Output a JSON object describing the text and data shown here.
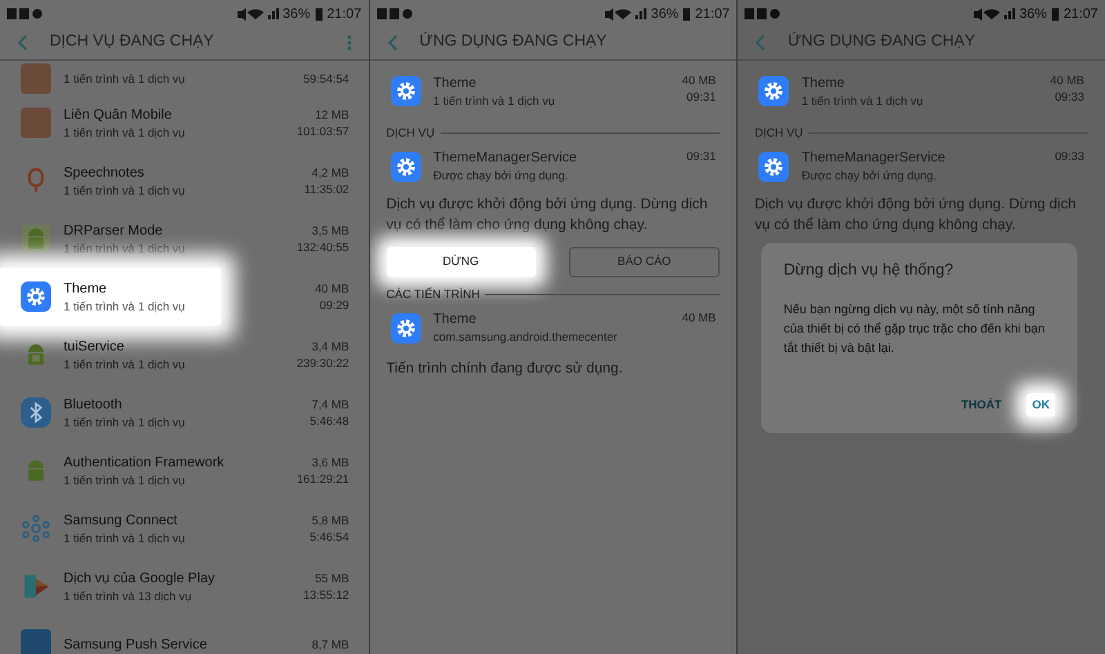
{
  "panels": [
    {
      "kind": "list",
      "status": {
        "battery": "36%",
        "time": "21:07"
      },
      "title": "DỊCH VỤ ĐANG CHẠY",
      "has_menu": true,
      "rows": [
        {
          "kind": "photo",
          "subtitle": "1 tiến trình và 1 dịch vụ",
          "time": "59:54:54",
          "highlighted": false
        },
        {
          "kind": "photo",
          "title": "Liên Quân Mobile",
          "subtitle": "1 tiến trình và 1 dịch vụ",
          "size": "12 MB",
          "time": "101:03:57",
          "highlighted": false
        },
        {
          "kind": "mic",
          "title": "Speechnotes",
          "subtitle": "1 tiến trình và 1 dịch vụ",
          "size": "4,2 MB",
          "time": "11:35:02",
          "highlighted": false
        },
        {
          "kind": "android-box",
          "title": "DRParser Mode",
          "subtitle": "1 tiến trình và 1 dịch vụ",
          "size": "3,5 MB",
          "time": "132:40:55",
          "highlighted": false
        },
        {
          "kind": "gear",
          "title": "Theme",
          "subtitle": "1 tiến trình và 1 dịch vụ",
          "size": "40 MB",
          "time": "09:29",
          "highlighted": true
        },
        {
          "kind": "android-cube",
          "title": "tuiService",
          "subtitle": "1 tiến trình và 1 dịch vụ",
          "size": "3,4 MB",
          "time": "239:30:22",
          "highlighted": false
        },
        {
          "kind": "bluetooth",
          "title": "Bluetooth",
          "subtitle": "1 tiến trình và 1 dịch vụ",
          "size": "7,4 MB",
          "time": "5:46:48",
          "highlighted": false
        },
        {
          "kind": "android",
          "title": "Authentication Framework",
          "subtitle": "1 tiến trình và 1 dịch vụ",
          "size": "3,6 MB",
          "time": "161:29:21",
          "highlighted": false
        },
        {
          "kind": "connect",
          "title": "Samsung Connect",
          "subtitle": "1 tiến trình và 1 dịch vụ",
          "size": "5,8 MB",
          "time": "5:46:54",
          "highlighted": false
        },
        {
          "kind": "puzzle",
          "title": "Dịch vụ của Google Play",
          "subtitle": "1 tiến trình và 13 dịch vụ",
          "size": "55 MB",
          "time": "13:55:12",
          "highlighted": false
        },
        {
          "kind": "push",
          "title": "Samsung Push Service",
          "size": "8,7 MB",
          "highlighted": false
        }
      ]
    },
    {
      "kind": "detail",
      "status": {
        "battery": "36%",
        "time": "21:07"
      },
      "title": "ỨNG DỤNG ĐANG CHẠY",
      "app": {
        "title": "Theme",
        "subtitle": "1 tiến trình và 1 dịch vụ",
        "size": "40 MB",
        "time": "09:31"
      },
      "service_header": "DỊCH VỤ",
      "service": {
        "title": "ThemeManagerService",
        "subtitle": "Được chạy bởi ứng dụng.",
        "time": "09:31"
      },
      "description": "Dịch vụ được khởi động bởi ứng dụng. Dừng dịch vụ có thể làm cho ứng dụng không chạy.",
      "buttons": [
        {
          "label": "DỪNG",
          "highlighted": true
        },
        {
          "label": "BÁO CÁO",
          "highlighted": false
        }
      ],
      "process_header": "CÁC TIẾN TRÌNH",
      "process": {
        "title": "Theme",
        "subtitle": "com.samsung.android.themecenter",
        "size": "40 MB"
      },
      "process_note": "Tiến trình chính đang được sử dụng."
    },
    {
      "kind": "dialog",
      "status": {
        "battery": "36%",
        "time": "21:07"
      },
      "title": "ỨNG DỤNG ĐANG CHẠY",
      "app": {
        "title": "Theme",
        "subtitle": "1 tiến trình và 1 dịch vụ",
        "size": "40 MB",
        "time": "09:33"
      },
      "service_header": "DỊCH VỤ",
      "service": {
        "title": "ThemeManagerService",
        "subtitle": "Được chạy bởi ứng dụng.",
        "time": "09:33"
      },
      "description": "Dịch vụ được khởi động bởi ứng dụng. Dừng dịch vụ có thể làm cho ứng dụng không chạy.",
      "dialog": {
        "title": "Dừng dịch vụ hệ thống?",
        "message": "Nếu bạn ngừng dịch vụ này, một số tính năng của thiết bị có thể gặp trục trặc cho đến khi bạn tắt thiết bị và bật lại.",
        "buttons": [
          {
            "label": "THOÁT",
            "highlighted": false
          },
          {
            "label": "OK",
            "highlighted": true
          }
        ]
      }
    }
  ]
}
